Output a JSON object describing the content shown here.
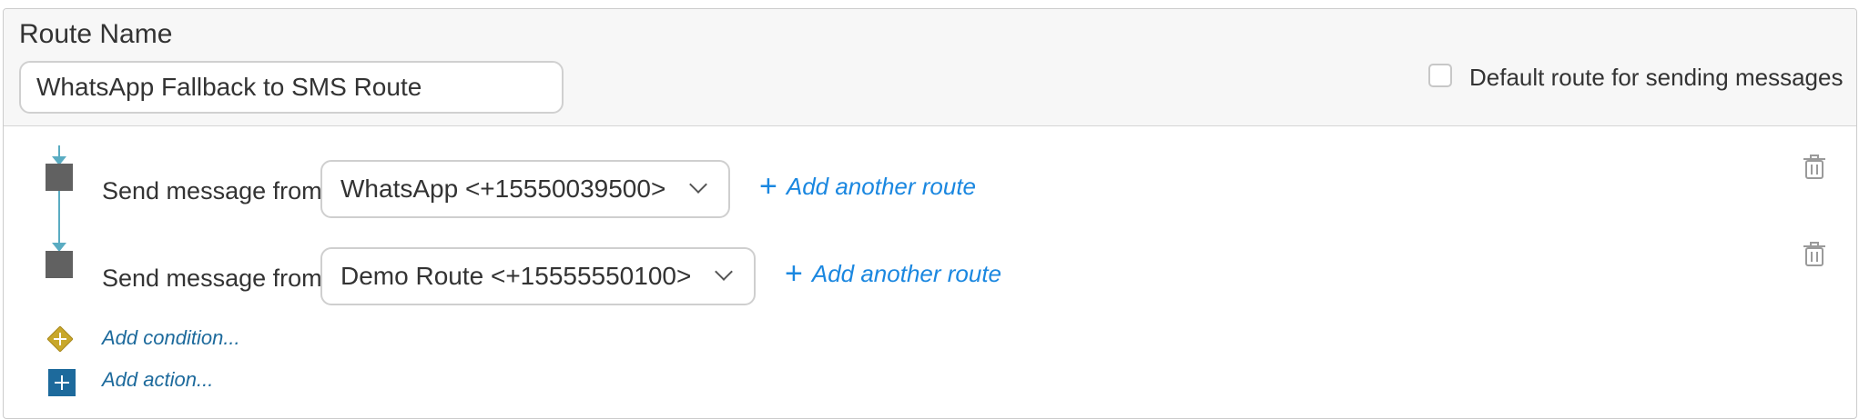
{
  "header": {
    "route_name_label": "Route Name",
    "route_name_value": "WhatsApp Fallback to SMS Route",
    "default_route_label": "Default route for sending messages",
    "default_route_checked": false
  },
  "steps": [
    {
      "send_label": "Send message from",
      "selected_route": "WhatsApp <+15550039500>",
      "add_route_label": "Add another route"
    },
    {
      "send_label": "Send message from",
      "selected_route": "Demo Route <+15555550100>",
      "add_route_label": "Add another route"
    }
  ],
  "add_condition_label": "Add condition...",
  "add_action_label": "Add action...",
  "colors": {
    "flow_line": "#5aacc2",
    "step_square": "#616161",
    "link_blue": "#1a87e0",
    "condition_gold": "#c8a72a",
    "action_blue": "#1d6a9c"
  },
  "icons": [
    "trash-icon",
    "plus-icon",
    "chevron-down-icon",
    "condition-diamond-icon",
    "action-plus-icon"
  ]
}
